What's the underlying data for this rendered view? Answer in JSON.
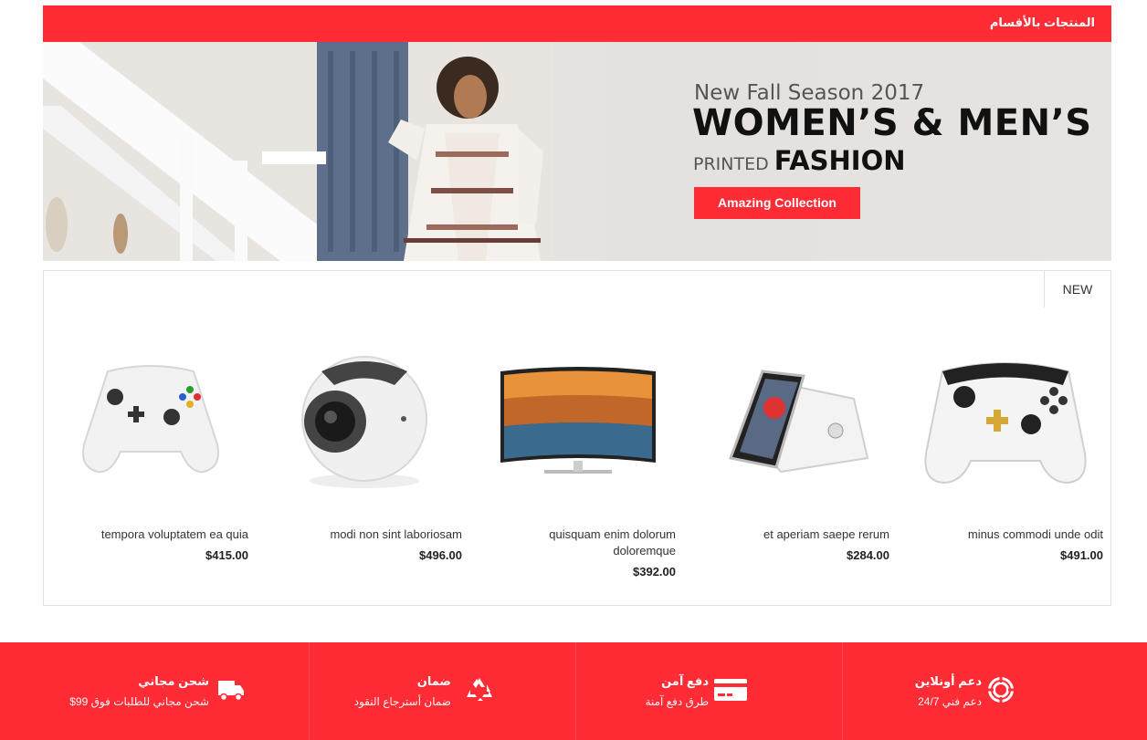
{
  "category_bar": {
    "label": "المنتجات بالأقسام"
  },
  "banner": {
    "season": "New Fall Season 2017",
    "headline": "WOMEN’S & MEN’S",
    "printed": "PRINTED",
    "fashion": "FASHION",
    "cta_label": "Amazing Collection"
  },
  "products": {
    "tab_label": "NEW",
    "items": [
      {
        "name": "tempora voluptatem ea quia",
        "price": "$415.00",
        "icon": "gamepad-controller"
      },
      {
        "name": "modi non sint laboriosam",
        "price": "$496.00",
        "icon": "360-camera"
      },
      {
        "name": "quisquam enim dolorum doloremque",
        "price": "$392.00",
        "icon": "curved-tv"
      },
      {
        "name": "et aperiam saepe rerum",
        "price": "$284.00",
        "icon": "smartphone"
      },
      {
        "name": "minus commodi unde odit",
        "price": "$491.00",
        "icon": "gamepad-controller-gold"
      }
    ]
  },
  "features": [
    {
      "title": "شحن مجاني",
      "desc": "شحن مجاني للطلبات فوق 99$",
      "icon": "truck-icon"
    },
    {
      "title": "ضمان",
      "desc": "ضمان أسترجاع النقود",
      "icon": "recycle-icon"
    },
    {
      "title": "دفع آمن",
      "desc": "طرق دفع آمنة",
      "icon": "credit-card-icon"
    },
    {
      "title": "دعم أونلاين",
      "desc": "دعم فني 24/7",
      "icon": "lifebuoy-icon"
    }
  ],
  "colors": {
    "accent": "#ff2b35"
  }
}
